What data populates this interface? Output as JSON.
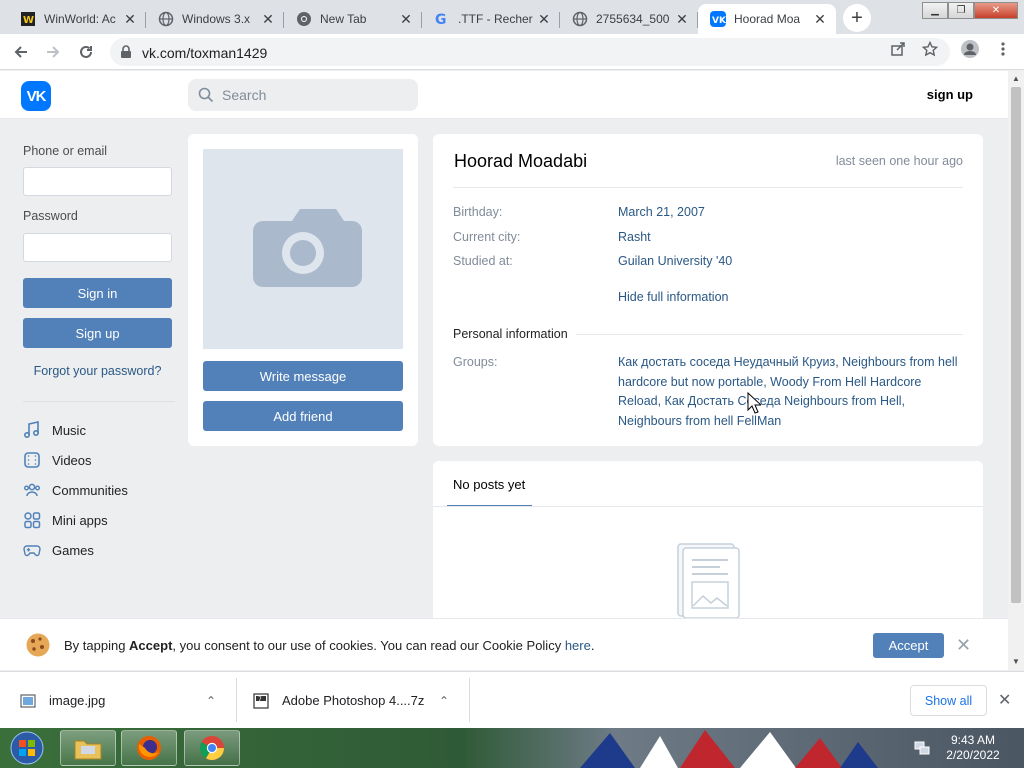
{
  "browser": {
    "tabs": [
      {
        "title": "WinWorld: Ac",
        "icon": "winworld-icon",
        "active": false
      },
      {
        "title": "Windows 3.x",
        "icon": "globe-icon",
        "active": false
      },
      {
        "title": "New Tab",
        "icon": "chrome-icon",
        "active": false
      },
      {
        "title": ".TTF - Recher",
        "icon": "google-icon",
        "active": false
      },
      {
        "title": "2755634_500",
        "icon": "globe-icon",
        "active": false
      },
      {
        "title": "Hoorad Moa",
        "icon": "vk-icon",
        "active": true
      }
    ],
    "url": "vk.com/toxman1429"
  },
  "header": {
    "logo": "VK",
    "search_placeholder": "Search",
    "signup": "sign up"
  },
  "login": {
    "phone_label": "Phone or email",
    "phone_value": "",
    "password_label": "Password",
    "password_value": "",
    "signin": "Sign in",
    "signup": "Sign up",
    "forgot": "Forgot your password?"
  },
  "menu": [
    {
      "label": "Music",
      "icon": "music-icon"
    },
    {
      "label": "Videos",
      "icon": "video-icon"
    },
    {
      "label": "Communities",
      "icon": "communities-icon"
    },
    {
      "label": "Mini apps",
      "icon": "apps-icon"
    },
    {
      "label": "Games",
      "icon": "gamepad-icon"
    }
  ],
  "profile": {
    "write_message": "Write message",
    "add_friend": "Add friend",
    "name": "Hoorad Moadabi",
    "last_seen": "last seen one hour ago",
    "birthday_label": "Birthday:",
    "birthday": "March 21, 2007",
    "city_label": "Current city:",
    "city": "Rasht",
    "studied_label": "Studied at:",
    "studied": "Guilan University '40",
    "hide_info": "Hide full information",
    "personal_section": "Personal information",
    "groups_label": "Groups:",
    "groups": "Как достать соседа Неудачный Круиз, Neighbours from hell hardcore but now portable, Woody From Hell Hardcore Reload, Как Достать Соседа Neighbours from Hell, Neighbours from hell FellMan"
  },
  "posts": {
    "tab": "No posts yet"
  },
  "cookie": {
    "prefix": "By tapping ",
    "accept_word": "Accept",
    "middle": ", you consent to our use of cookies. You can read our Cookie Policy ",
    "link": "here",
    "suffix": ".",
    "accept_button": "Accept"
  },
  "downloads": {
    "items": [
      {
        "name": "image.jpg",
        "icon": "image-file-icon"
      },
      {
        "name": "Adobe Photoshop 4....7z",
        "icon": "archive-file-icon"
      }
    ],
    "show_all": "Show all"
  },
  "taskbar": {
    "time": "9:43 AM",
    "date": "2/20/2022"
  },
  "colors": {
    "vk_blue": "#5181b8",
    "link": "#2a5885",
    "page_bg": "#edeef0"
  }
}
